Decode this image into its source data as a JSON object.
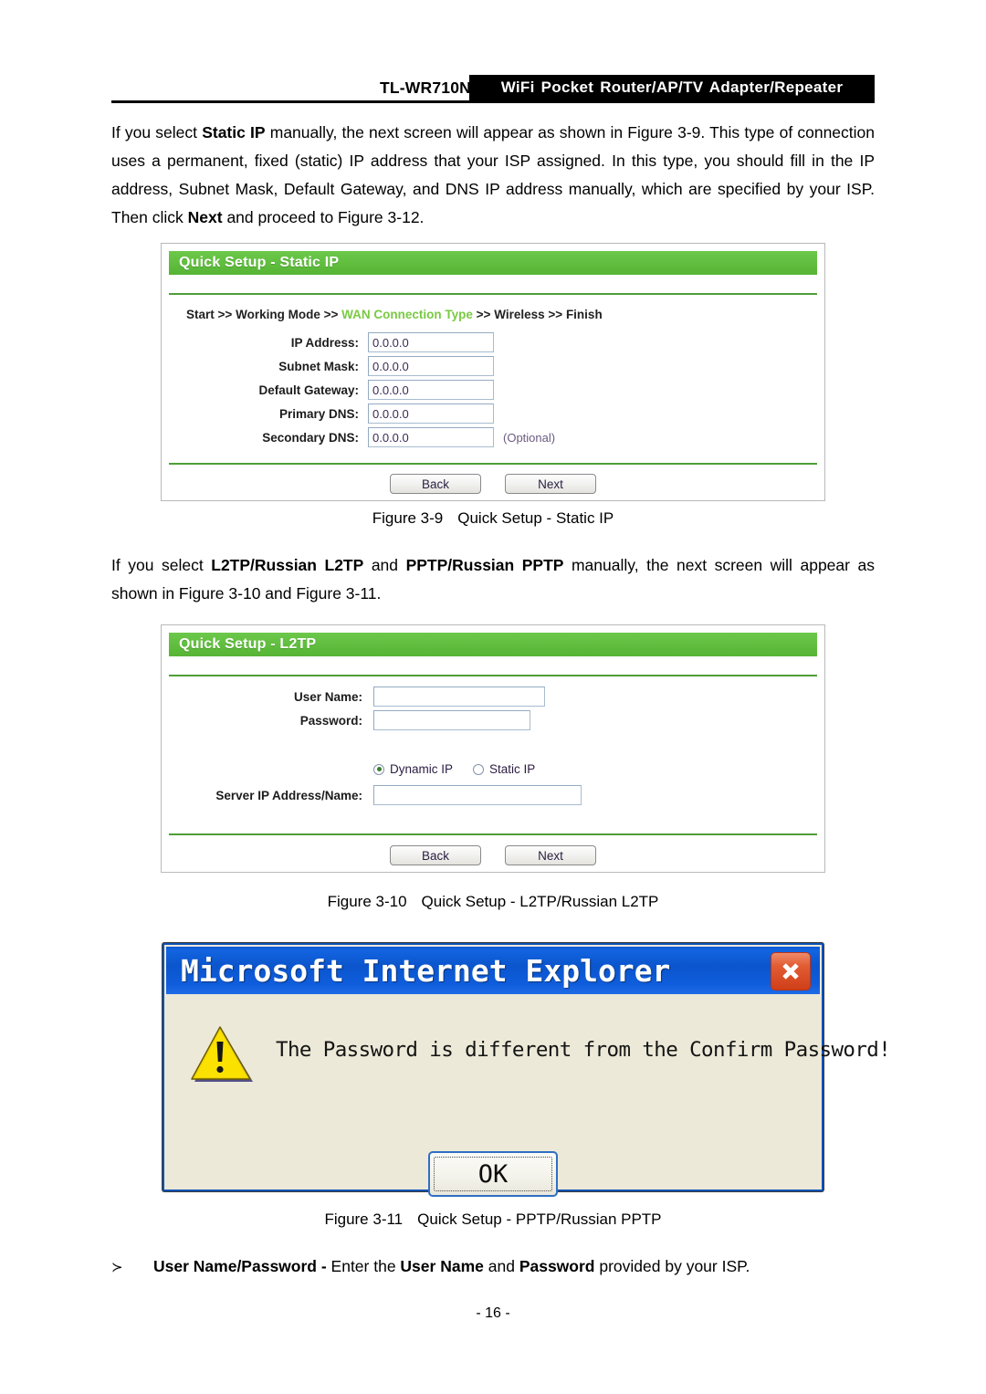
{
  "header": {
    "model": "TL-WR710N",
    "banner": "WiFi Pocket Router/AP/TV Adapter/Repeater"
  },
  "paragraph1": {
    "seg1": "If you select ",
    "bold1": "Static IP",
    "seg2": " manually, the next screen will appear as shown in Figure 3-9. This type of connection uses a permanent, fixed (static) IP address that your ISP assigned. In this type, you should fill in the IP address, Subnet Mask, Default Gateway, and DNS IP address manually, which are specified by your ISP. Then click ",
    "bold2": "Next",
    "seg3": " and proceed to Figure 3-12."
  },
  "paragraph2": {
    "seg1": "If you select ",
    "bold1": "L2TP/Russian L2TP",
    "seg2": " and ",
    "bold2": "PPTP/Russian PPTP",
    "seg3": " manually, the next screen will appear as shown in Figure 3-10 and Figure 3-11."
  },
  "figure_static_ip": {
    "title": "Quick Setup - Static IP",
    "breadcrumb": {
      "step1": "Start",
      "step2": "Working Mode",
      "step3": "WAN Connection Type",
      "step4": "Wireless",
      "step5": "Finish",
      "separator": ">>"
    },
    "fields": [
      {
        "label": "IP Address:",
        "value": "0.0.0.0",
        "note": ""
      },
      {
        "label": "Subnet Mask:",
        "value": "0.0.0.0",
        "note": ""
      },
      {
        "label": "Default Gateway:",
        "value": "0.0.0.0",
        "note": ""
      },
      {
        "label": "Primary DNS:",
        "value": "0.0.0.0",
        "note": ""
      },
      {
        "label": "Secondary DNS:",
        "value": "0.0.0.0",
        "note": "(Optional)"
      }
    ],
    "back_label": "Back",
    "next_label": "Next",
    "caption_number": "Figure 3-9",
    "caption_text": "Quick Setup - Static IP"
  },
  "figure_l2tp": {
    "title": "Quick Setup - L2TP",
    "fields": [
      {
        "label": "User Name:",
        "value": ""
      },
      {
        "label": "Password:",
        "value": ""
      }
    ],
    "radios": [
      {
        "label": "Dynamic IP",
        "checked": true
      },
      {
        "label": "Static IP",
        "checked": false
      }
    ],
    "server_field": {
      "label": "Server IP Address/Name:",
      "value": ""
    },
    "back_label": "Back",
    "next_label": "Next",
    "caption_number": "Figure 3-10",
    "caption_text": "Quick Setup - L2TP/Russian L2TP"
  },
  "figure_dialog": {
    "window_title": "Microsoft Internet Explorer",
    "message": "The Password is different from the Confirm Password!",
    "ok_label": "OK",
    "close_icon": "close-x-icon",
    "warning_icon": "warning-triangle-icon",
    "caption_number": "Figure 3-11",
    "caption_text": "Quick Setup - PPTP/Russian PPTP"
  },
  "bullet": {
    "marker": "≻",
    "bold1": "User Name/Password -",
    "seg1": " Enter the ",
    "bold2": "User Name",
    "seg2": " and ",
    "bold3": "Password",
    "seg3": " provided by your ISP."
  },
  "page_number": "- 16 -",
  "colors": {
    "brand_green": "#5ebd3c",
    "breadcrumb_active": "#7ac943",
    "dialog_titlebar_blue": "#0b55cd",
    "dialog_close_red": "#cf3f18",
    "dialog_face": "#ece9d8",
    "warning_yellow": "#f5d800"
  }
}
